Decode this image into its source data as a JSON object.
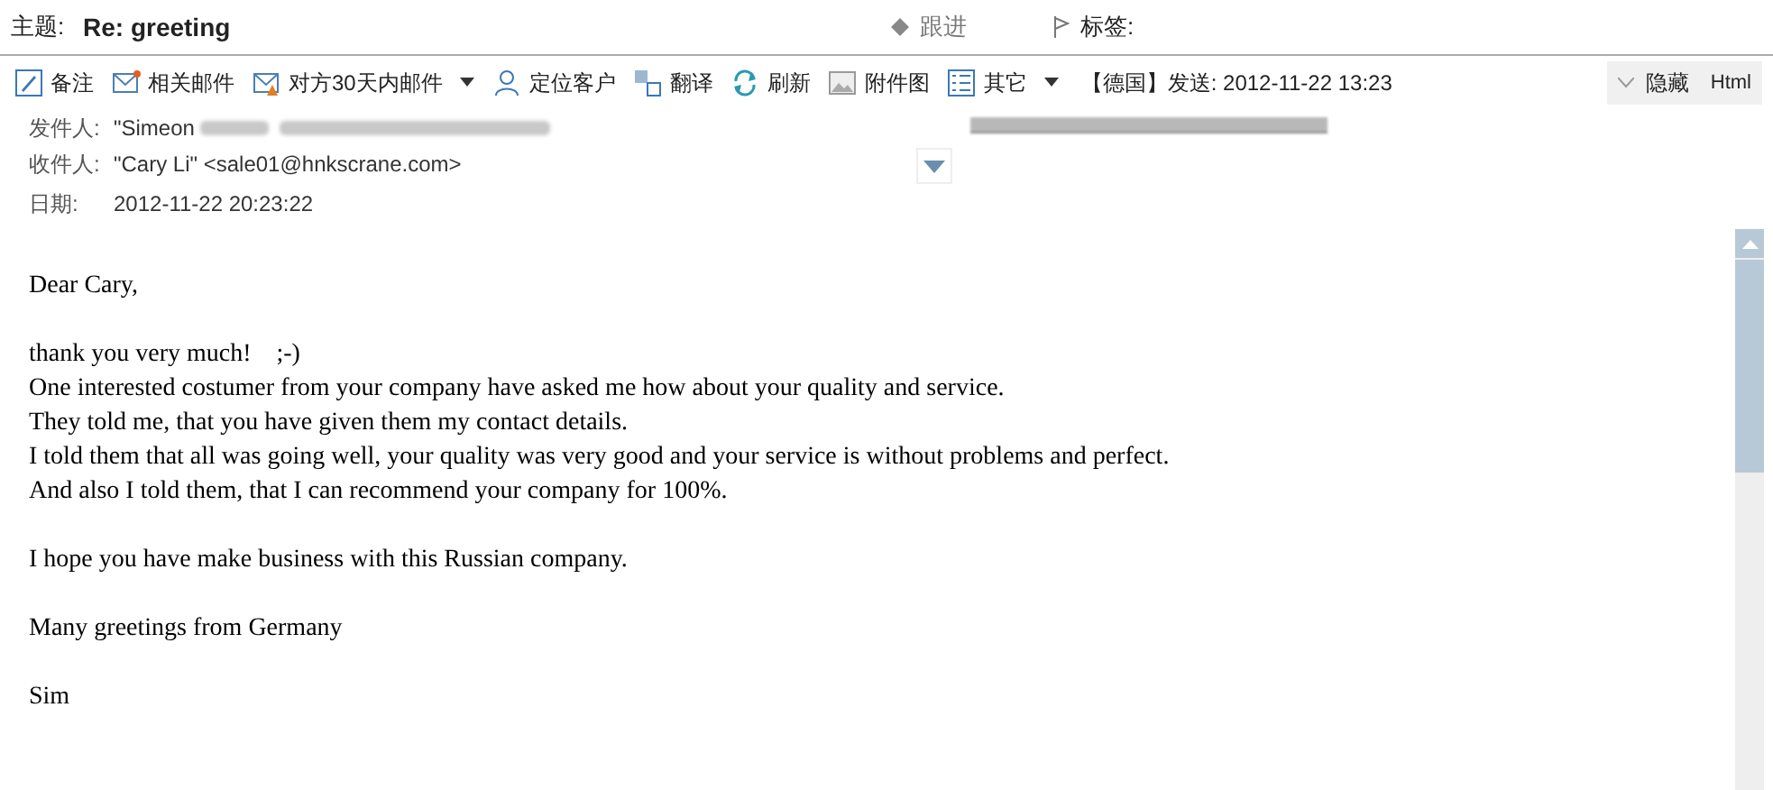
{
  "subject": {
    "label": "主题:",
    "value": "Re: greeting"
  },
  "follow_up": {
    "label": "跟进"
  },
  "tags": {
    "label": "标签:"
  },
  "toolbar": {
    "items": [
      {
        "label": "备注",
        "dropdown": false
      },
      {
        "label": "相关邮件",
        "dropdown": false
      },
      {
        "label": "对方30天内邮件",
        "dropdown": true
      },
      {
        "label": "定位客户",
        "dropdown": false
      },
      {
        "label": "翻译",
        "dropdown": false
      },
      {
        "label": "刷新",
        "dropdown": false
      },
      {
        "label": "附件图",
        "dropdown": false
      },
      {
        "label": "其它",
        "dropdown": true
      }
    ],
    "sent_info": "【德国】发送: 2012-11-22 13:23",
    "hide_button": "隐藏",
    "html_button": "Html"
  },
  "header": {
    "from_label": "发件人:",
    "from_name": "\"Simeon",
    "to_label": "收件人:",
    "to_value": "\"Cary Li\" <sale01@hnkscrane.com>",
    "date_label": "日期:",
    "date_value": "2012-11-22 20:23:22"
  },
  "body": {
    "paragraphs": [
      [
        "Dear Cary,"
      ],
      [
        "thank you very much!    ;-)",
        "One interested costumer from your company have asked me how about your quality and service.",
        "They told me, that you have given them my contact details.",
        "I told them that all was going well, your quality was very good and your service is without problems and perfect.",
        "And also I told them, that I can recommend your company for 100%."
      ],
      [
        "I hope you have make business with this Russian company."
      ],
      [
        "Many greetings from Germany"
      ],
      [
        "Sim"
      ]
    ]
  }
}
